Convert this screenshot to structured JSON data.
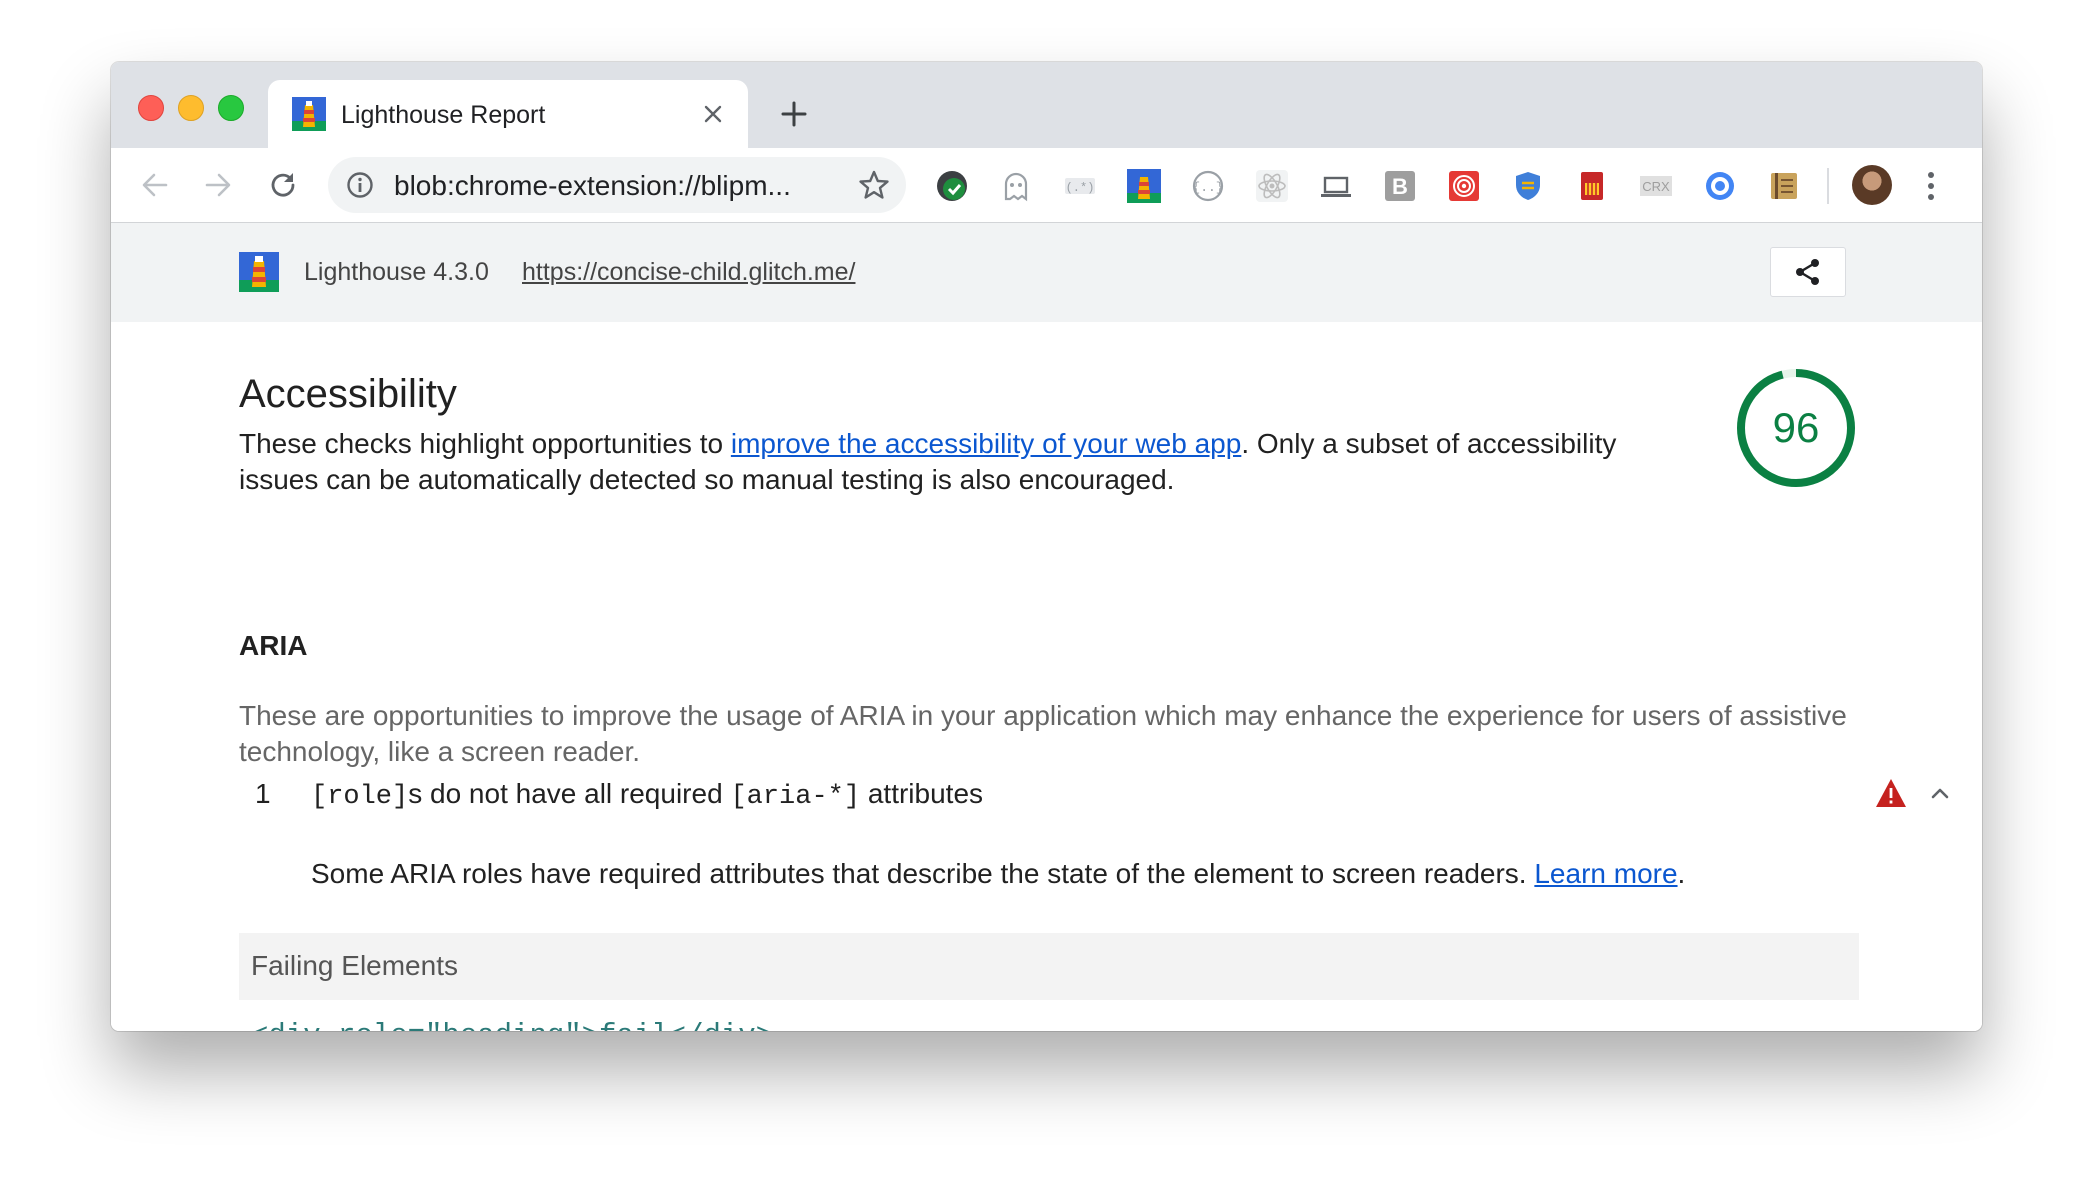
{
  "browser": {
    "tab": {
      "title": "Lighthouse Report"
    },
    "omnibox": {
      "url": "blob:chrome-extension://blipm..."
    }
  },
  "header": {
    "version": "Lighthouse 4.3.0",
    "url": "https://concise-child.glitch.me/"
  },
  "category": {
    "title": "Accessibility",
    "description_before": "These checks highlight opportunities to ",
    "description_link": "improve the accessibility of your web app",
    "description_after": ". Only a subset of accessibility issues can be automatically detected so manual testing is also encouraged.",
    "score": "96",
    "score_fraction": 0.96,
    "score_color": "#0b8043"
  },
  "group": {
    "title": "ARIA",
    "description": "These are opportunities to improve the usage of ARIA in your application which may enhance the experience for users of assistive technology, like a screen reader."
  },
  "audit": {
    "index": "1",
    "title_code_1": "[role]",
    "title_text_1": "s do not have all required ",
    "title_code_2": "[aria-*]",
    "title_text_2": " attributes",
    "description": "Some ARIA roles have required attributes that describe the state of the element to screen readers. ",
    "learn_more": "Learn more",
    "description_end": ".",
    "status_color": "#c5221f",
    "table_header": "Failing Elements",
    "node_snippet": "<div role=\"heading\">fail</div>"
  },
  "extensions": [
    {
      "name": "green-check-extension-icon",
      "color": "#1e8e3e"
    },
    {
      "name": "ghost-extension-icon",
      "color": "#9aa0a6"
    },
    {
      "name": "regex-extension-icon",
      "color": "#9aa0a6"
    },
    {
      "name": "lighthouse-extension-icon",
      "color": "#3367d6"
    },
    {
      "name": "json-extension-icon",
      "color": "#9aa0a6"
    },
    {
      "name": "react-extension-icon",
      "color": "#bdbdbd"
    },
    {
      "name": "laptop-extension-icon",
      "color": "#5f6368"
    },
    {
      "name": "b-extension-icon",
      "color": "#9e9e9e"
    },
    {
      "name": "spiral-extension-icon",
      "color": "#e53935"
    },
    {
      "name": "shield-extension-icon",
      "color": "#3f7fd9"
    },
    {
      "name": "sd-card-extension-icon",
      "color": "#c62828"
    },
    {
      "name": "crx-extension-icon",
      "color": "#9e9e9e",
      "label": "CRX"
    },
    {
      "name": "target-extension-icon",
      "color": "#4285f4"
    },
    {
      "name": "notebook-extension-icon",
      "color": "#c9a35c"
    }
  ]
}
